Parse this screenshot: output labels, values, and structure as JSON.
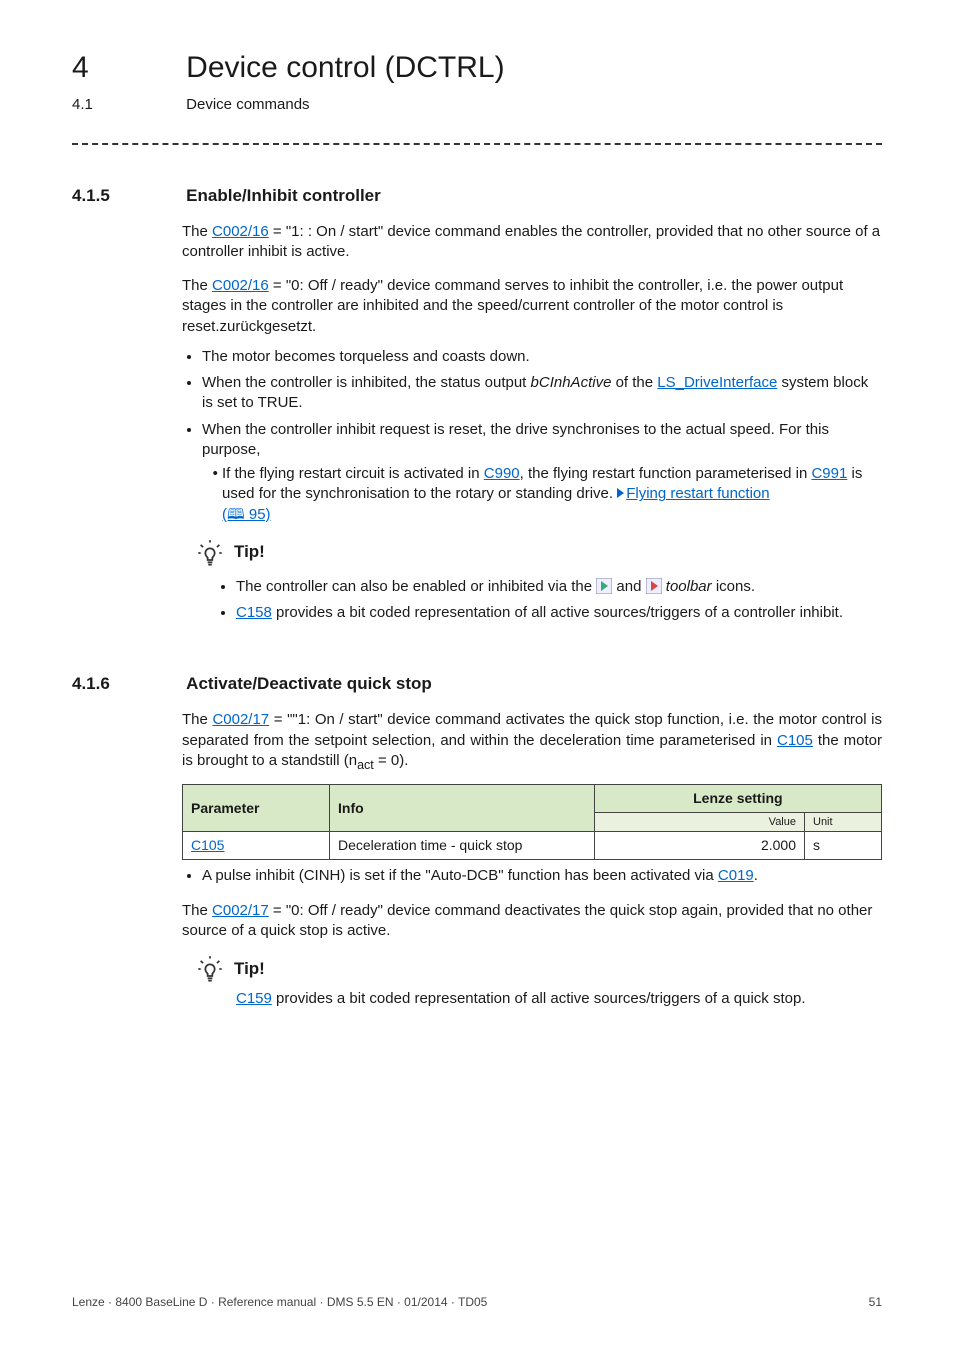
{
  "chapter": {
    "num": "4",
    "title": "Device control (DCTRL)"
  },
  "sub": {
    "num": "4.1",
    "title": "Device commands"
  },
  "sec415": {
    "num": "4.1.5",
    "title": "Enable/Inhibit controller",
    "p1a": "The ",
    "p1link": "C002/16",
    "p1b": " = \"1: : On / start\" device command enables the controller, provided that no other source of a controller inhibit is active.",
    "p2a": "The ",
    "p2link": "C002/16",
    "p2b": " = \"0: Off / ready\" device command serves to inhibit the controller, i.e. the power output stages in the controller are inhibited and the speed/current controller of the motor control is reset.zurückgesetzt.",
    "b1": "The motor becomes torqueless and coasts down.",
    "b2a": "When the controller is inhibited, the status output ",
    "b2i": "bCInhActive",
    "b2b": " of the ",
    "b2link": "LS_DriveInterface",
    "b2c": " system block is set to TRUE.",
    "b3": "When the controller inhibit request is reset, the drive synchronises to the actual speed. For this purpose,",
    "b3s1a": "If the flying restart circuit is activated in ",
    "b3s1l1": "C990",
    "b3s1b": ", the flying restart function parameterised in ",
    "b3s1l2": "C991",
    "b3s1c": " is used for the synchronisation to the rotary or standing drive.  ",
    "b3s1l3": "Flying restart function",
    "b3s1d": "(🕮 95)",
    "tiplabel": "Tip!",
    "tip1a": "The controller can also be enabled or inhibited via the ",
    "tip1b": " and ",
    "tip1c": " toolbar",
    "tip1d": " icons.",
    "tip2l": "C158",
    "tip2": " provides a bit coded representation of all active sources/triggers of a controller inhibit."
  },
  "sec416": {
    "num": "4.1.6",
    "title": "Activate/Deactivate quick stop",
    "p1a": "The ",
    "p1l": "C002/17",
    "p1b": " = \"\"1: On / start\" device command activates the quick stop function, i.e. the motor control is separated from the setpoint selection, and within the deceleration time parameterised in ",
    "p1l2": "C105",
    "p1c": " the motor is brought to a standstill (n",
    "p1sub": "act",
    "p1d": " = 0).",
    "thParam": "Parameter",
    "thInfo": "Info",
    "thLenze": "Lenze setting",
    "thValue": "Value",
    "thUnit": "Unit",
    "rowParam": "C105",
    "rowInfo": "Deceleration time - quick stop",
    "rowValue": "2.000",
    "rowUnit": "s",
    "note1a": "A pulse inhibit (CINH) is set if the \"Auto-DCB\" function has been activated via ",
    "note1l": "C019",
    "note1b": ".",
    "p2a": "The ",
    "p2l": "C002/17",
    "p2b": " = \"0: Off / ready\" device command deactivates the quick stop again, provided that no other source of a quick stop is active.",
    "tiplabel": "Tip!",
    "tipl": "C159",
    "tip": " provides a bit coded representation of all active sources/triggers of a quick stop."
  },
  "footer": {
    "left": "Lenze · 8400 BaseLine D · Reference manual · DMS 5.5 EN · 01/2014 · TD05",
    "right": "51"
  },
  "chart_data": {
    "type": "table",
    "columns": [
      "Parameter",
      "Info",
      "Lenze setting Value",
      "Lenze setting Unit"
    ],
    "rows": [
      [
        "C105",
        "Deceleration time - quick stop",
        2.0,
        "s"
      ]
    ]
  }
}
